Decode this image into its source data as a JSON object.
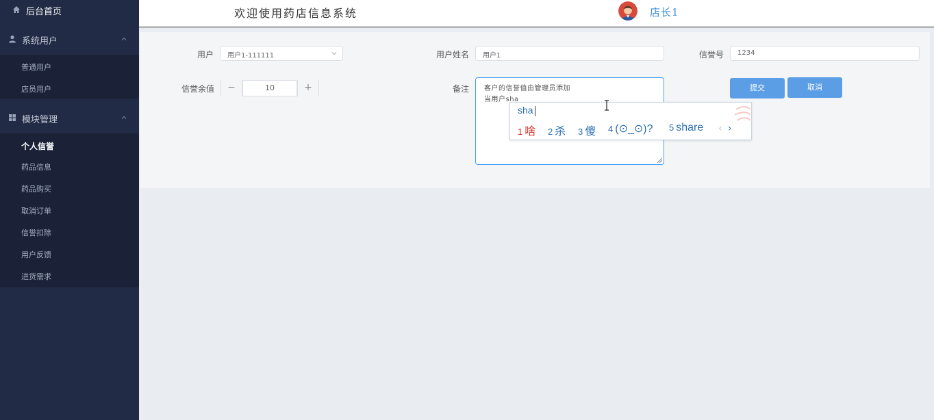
{
  "sidebar": {
    "home_label": "后台首页",
    "groups": [
      {
        "label": "系统用户",
        "items": [
          "普通用户",
          "店员用户"
        ]
      },
      {
        "label": "模块管理",
        "items": [
          "个人信誉",
          "药品信息",
          "药品购买",
          "取消订单",
          "信誉扣除",
          "用户反馈",
          "进货需求"
        ]
      }
    ]
  },
  "header": {
    "title": "欢迎使用药店信息系统",
    "user_name": "店长1"
  },
  "form": {
    "user_label": "用户",
    "user_value": "用户1-111111",
    "username_label": "用户姓名",
    "username_value": "用户1",
    "credit_no_label": "信誉号",
    "credit_no_value": "1234",
    "balance_label": "信誉余值",
    "balance_value": "10",
    "minus_symbol": "−",
    "plus_symbol": "+",
    "remark_label": "备注",
    "remark_line1": "客户的信誉值由管理员添加",
    "remark_line2": "当用户sha",
    "submit_label": "提交",
    "cancel_label": "取消"
  },
  "ime": {
    "composition": "sha",
    "candidates": [
      {
        "num": "1",
        "text": "啥"
      },
      {
        "num": "2",
        "text": "杀"
      },
      {
        "num": "3",
        "text": "傻"
      },
      {
        "num": "4",
        "text": "(⊙_⊙)?"
      },
      {
        "num": "5",
        "text": "share"
      }
    ],
    "prev": "‹",
    "next": "›"
  },
  "colors": {
    "sidebar_bg": "#222b45",
    "accent": "#409eff",
    "button": "#5b9ee6",
    "ime_highlight": "#d3302a"
  }
}
